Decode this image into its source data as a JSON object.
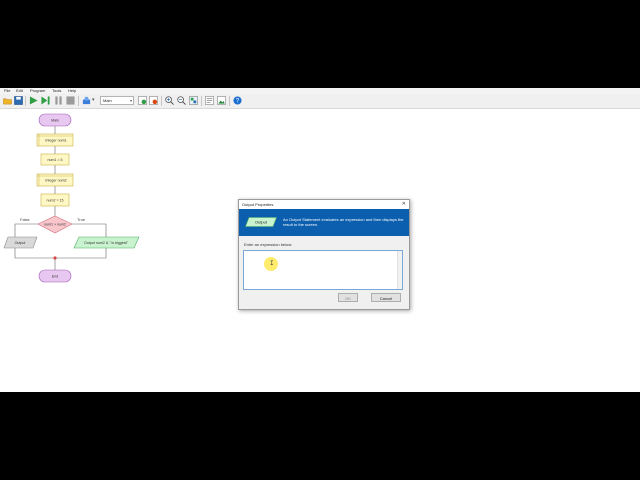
{
  "menu": {
    "file": "File",
    "edit": "Edit",
    "program": "Program",
    "tools": "Tools",
    "help": "Help"
  },
  "toolbar": {
    "function_select": "Main",
    "icons": [
      "open-folder-icon",
      "save-icon",
      "run-icon",
      "step-icon",
      "pause-icon",
      "stop-icon",
      "speed-icon",
      "zoom-in-icon",
      "zoom-out-icon",
      "layout-icon",
      "image-icon",
      "help-icon"
    ]
  },
  "flowchart": {
    "start": "Main",
    "declare1": "Integer num1",
    "assign1": "num1 = 5",
    "declare2": "Integer num2",
    "assign2": "num2 = 15",
    "condition": "num1 > num2",
    "false_label": "False",
    "true_label": "True",
    "output_false": "Output",
    "output_true": "Output num2 & \" is biggest\"",
    "end": "End"
  },
  "dialog": {
    "title": "Output Properties",
    "close": "✕",
    "badge": "Output",
    "description": "An Output Statement evaluates an expression and then displays the result to the screen.",
    "prompt": "Enter an expression below:",
    "expression_value": "",
    "ok_label": "OK",
    "cancel_label": "Cancel",
    "banner_color": "#0b5fae"
  }
}
